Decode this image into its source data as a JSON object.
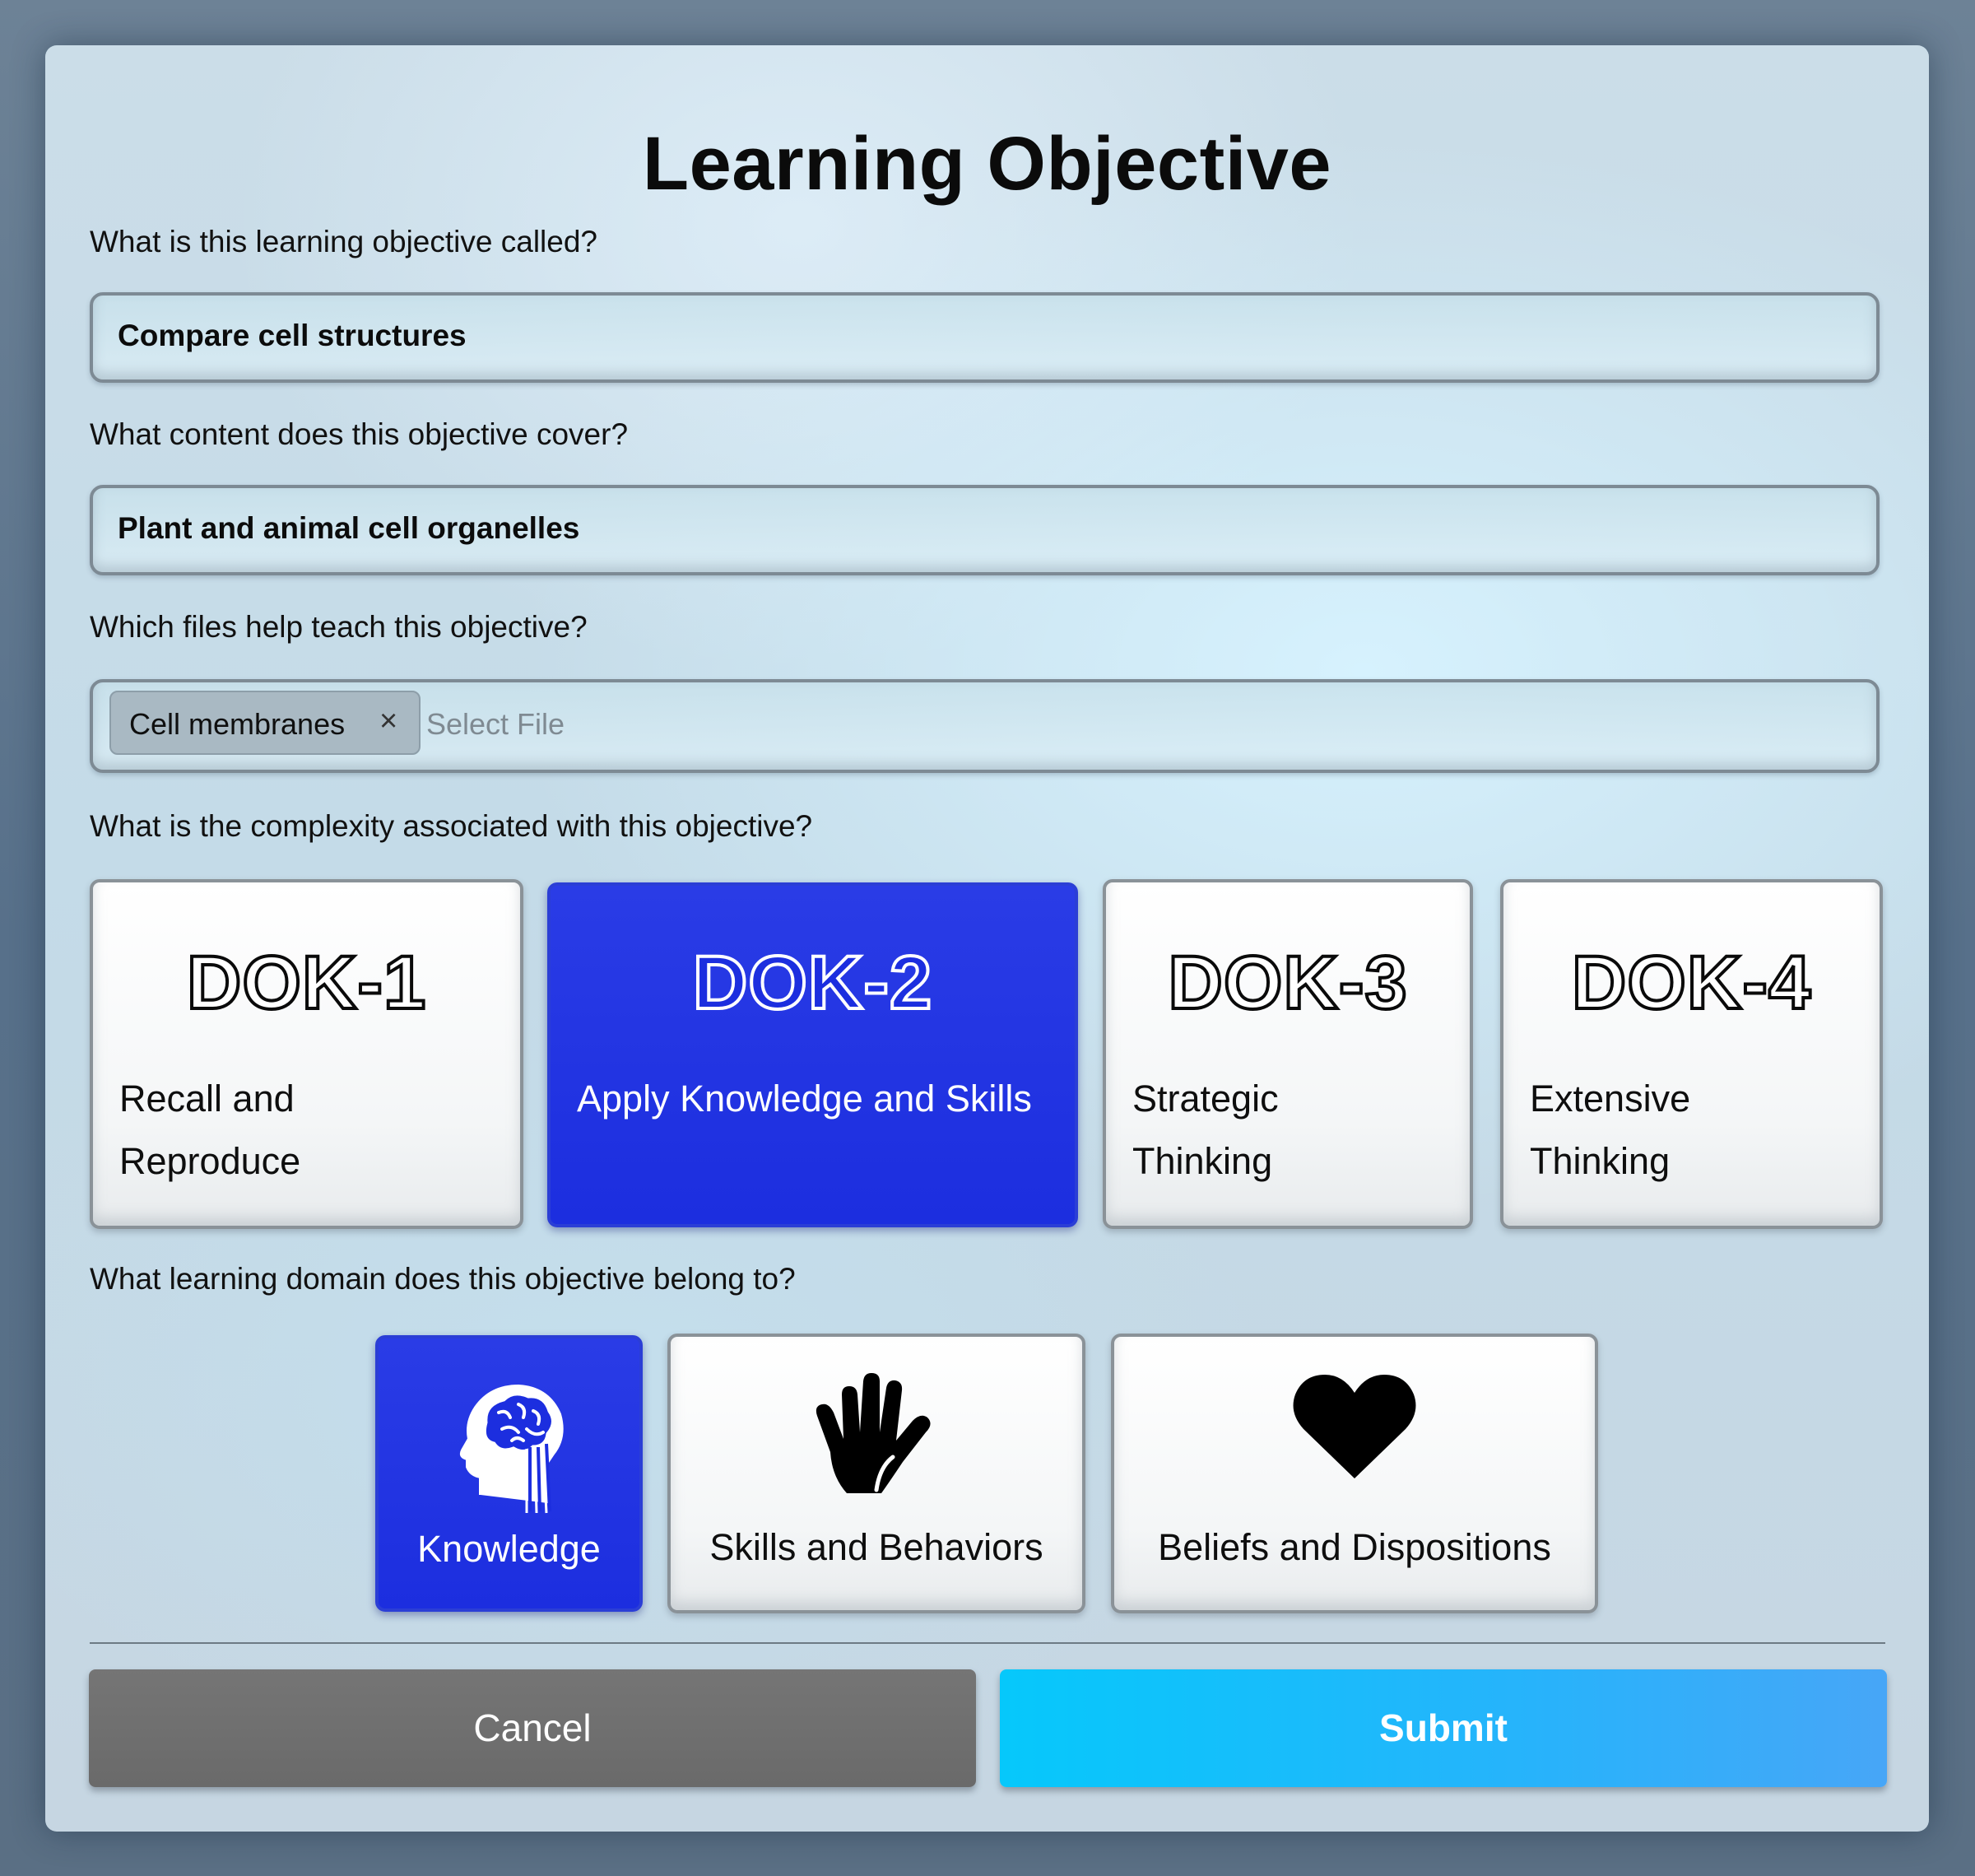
{
  "dialog": {
    "title": "Learning Objective"
  },
  "name_field": {
    "label": "What is this learning objective called?",
    "value": "Compare cell structures"
  },
  "content_field": {
    "label": "What content does this objective cover?",
    "value": "Plant and animal cell organelles"
  },
  "files_field": {
    "label": "Which files help teach this objective?",
    "chips": [
      {
        "label": "Cell membranes",
        "remove": "×"
      }
    ],
    "placeholder": "Select File"
  },
  "complexity": {
    "label": "What is the complexity associated with this objective?",
    "selected": "DOK-2",
    "options": [
      {
        "code": "DOK-1",
        "description": "Recall and Reproduce"
      },
      {
        "code": "DOK-2",
        "description": "Apply Knowledge and Skills"
      },
      {
        "code": "DOK-3",
        "description": "Strategic Thinking"
      },
      {
        "code": "DOK-4",
        "description": "Extensive Thinking"
      }
    ]
  },
  "domain": {
    "label": "What learning domain does this objective belong to?",
    "selected": "Knowledge",
    "options": [
      {
        "label": "Knowledge",
        "icon": "brain-head-icon"
      },
      {
        "label": "Skills and Behaviors",
        "icon": "hand-icon"
      },
      {
        "label": "Beliefs and Dispositions",
        "icon": "heart-icon"
      }
    ]
  },
  "actions": {
    "cancel_label": "Cancel",
    "submit_label": "Submit"
  },
  "colors": {
    "selected_card": "#1c2edf",
    "submit_start": "#06c8fb",
    "submit_end": "#47a6f7",
    "cancel": "#6e6e6e"
  }
}
